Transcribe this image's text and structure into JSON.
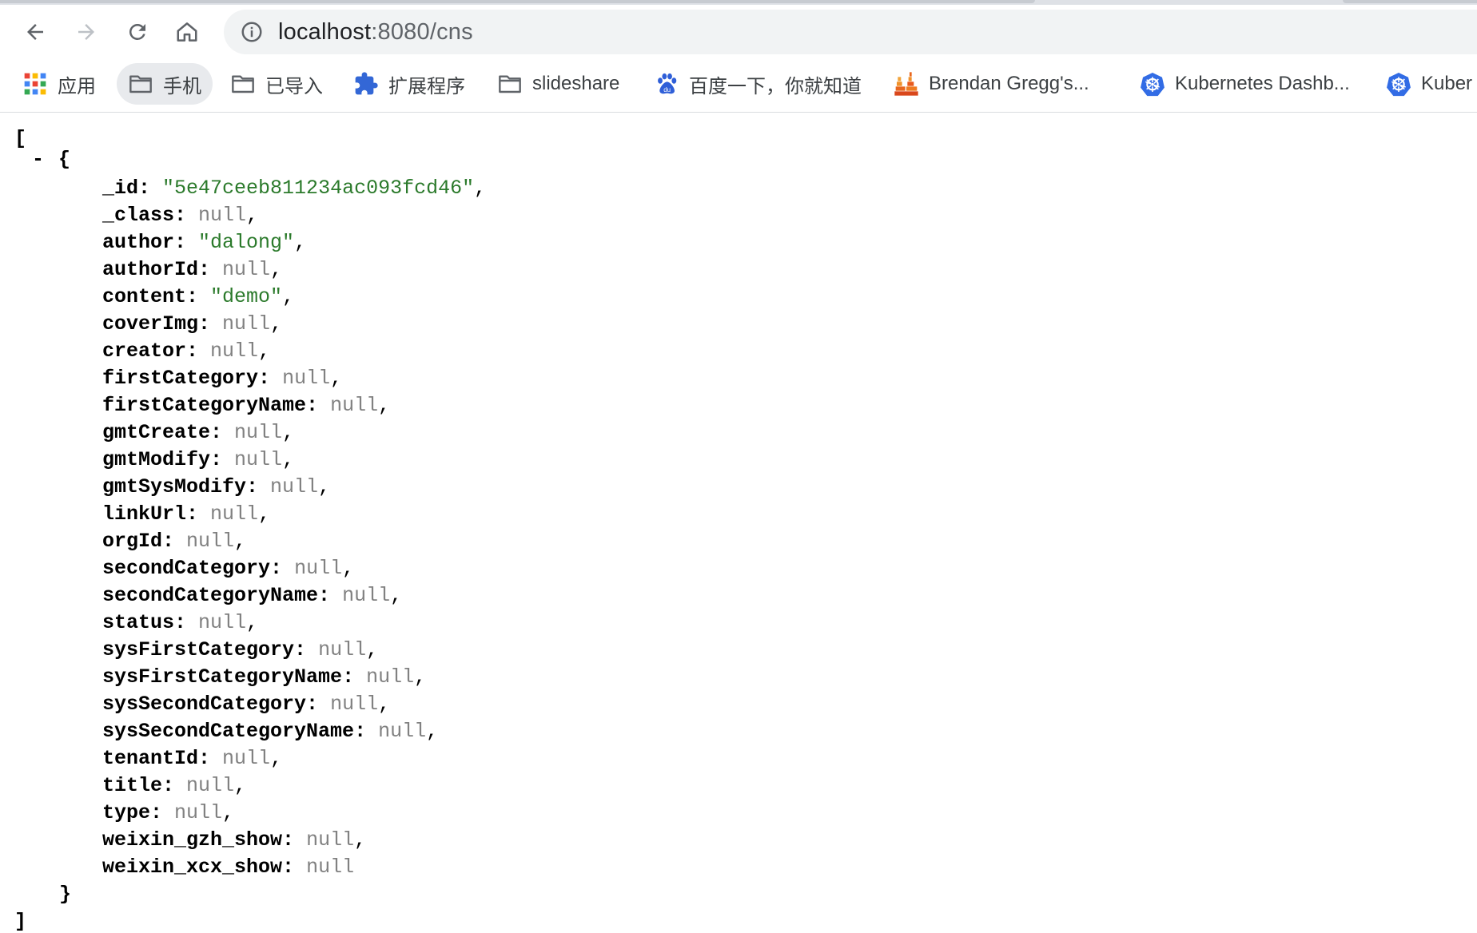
{
  "browser": {
    "url_host": "localhost",
    "url_rest": ":8080/cns",
    "bookmarks": [
      {
        "label": "应用",
        "icon": "apps-grid-icon"
      },
      {
        "label": "手机",
        "icon": "folder-icon"
      },
      {
        "label": "已导入",
        "icon": "folder-icon"
      },
      {
        "label": "扩展程序",
        "icon": "puzzle-icon"
      },
      {
        "label": "slideshare",
        "icon": "folder-icon"
      },
      {
        "label": "百度一下，你就知道",
        "icon": "baidu-paw-icon"
      },
      {
        "label": "Brendan Gregg's...",
        "icon": "flamegraph-icon"
      },
      {
        "label": "Kubernetes Dashb...",
        "icon": "kubernetes-icon"
      },
      {
        "label": "Kuber",
        "icon": "kubernetes-icon"
      }
    ]
  },
  "json_view": {
    "open_bracket": "[",
    "close_bracket": "]",
    "collapse_toggle": "-",
    "open_brace": "{",
    "close_brace": "}",
    "entries": [
      {
        "key": "_id",
        "value": "\"5e47ceeb811234ac093fcd46\"",
        "type": "string",
        "comma": ","
      },
      {
        "key": "_class",
        "value": "null",
        "type": "null",
        "comma": ","
      },
      {
        "key": "author",
        "value": "\"dalong\"",
        "type": "string",
        "comma": ","
      },
      {
        "key": "authorId",
        "value": "null",
        "type": "null",
        "comma": ","
      },
      {
        "key": "content",
        "value": "\"demo\"",
        "type": "string",
        "comma": ","
      },
      {
        "key": "coverImg",
        "value": "null",
        "type": "null",
        "comma": ","
      },
      {
        "key": "creator",
        "value": "null",
        "type": "null",
        "comma": ","
      },
      {
        "key": "firstCategory",
        "value": "null",
        "type": "null",
        "comma": ","
      },
      {
        "key": "firstCategoryName",
        "value": "null",
        "type": "null",
        "comma": ","
      },
      {
        "key": "gmtCreate",
        "value": "null",
        "type": "null",
        "comma": ","
      },
      {
        "key": "gmtModify",
        "value": "null",
        "type": "null",
        "comma": ","
      },
      {
        "key": "gmtSysModify",
        "value": "null",
        "type": "null",
        "comma": ","
      },
      {
        "key": "linkUrl",
        "value": "null",
        "type": "null",
        "comma": ","
      },
      {
        "key": "orgId",
        "value": "null",
        "type": "null",
        "comma": ","
      },
      {
        "key": "secondCategory",
        "value": "null",
        "type": "null",
        "comma": ","
      },
      {
        "key": "secondCategoryName",
        "value": "null",
        "type": "null",
        "comma": ","
      },
      {
        "key": "status",
        "value": "null",
        "type": "null",
        "comma": ","
      },
      {
        "key": "sysFirstCategory",
        "value": "null",
        "type": "null",
        "comma": ","
      },
      {
        "key": "sysFirstCategoryName",
        "value": "null",
        "type": "null",
        "comma": ","
      },
      {
        "key": "sysSecondCategory",
        "value": "null",
        "type": "null",
        "comma": ","
      },
      {
        "key": "sysSecondCategoryName",
        "value": "null",
        "type": "null",
        "comma": ","
      },
      {
        "key": "tenantId",
        "value": "null",
        "type": "null",
        "comma": ","
      },
      {
        "key": "title",
        "value": "null",
        "type": "null",
        "comma": ","
      },
      {
        "key": "type",
        "value": "null",
        "type": "null",
        "comma": ","
      },
      {
        "key": "weixin_gzh_show",
        "value": "null",
        "type": "null",
        "comma": ","
      },
      {
        "key": "weixin_xcx_show",
        "value": "null",
        "type": "null",
        "comma": ""
      }
    ]
  }
}
